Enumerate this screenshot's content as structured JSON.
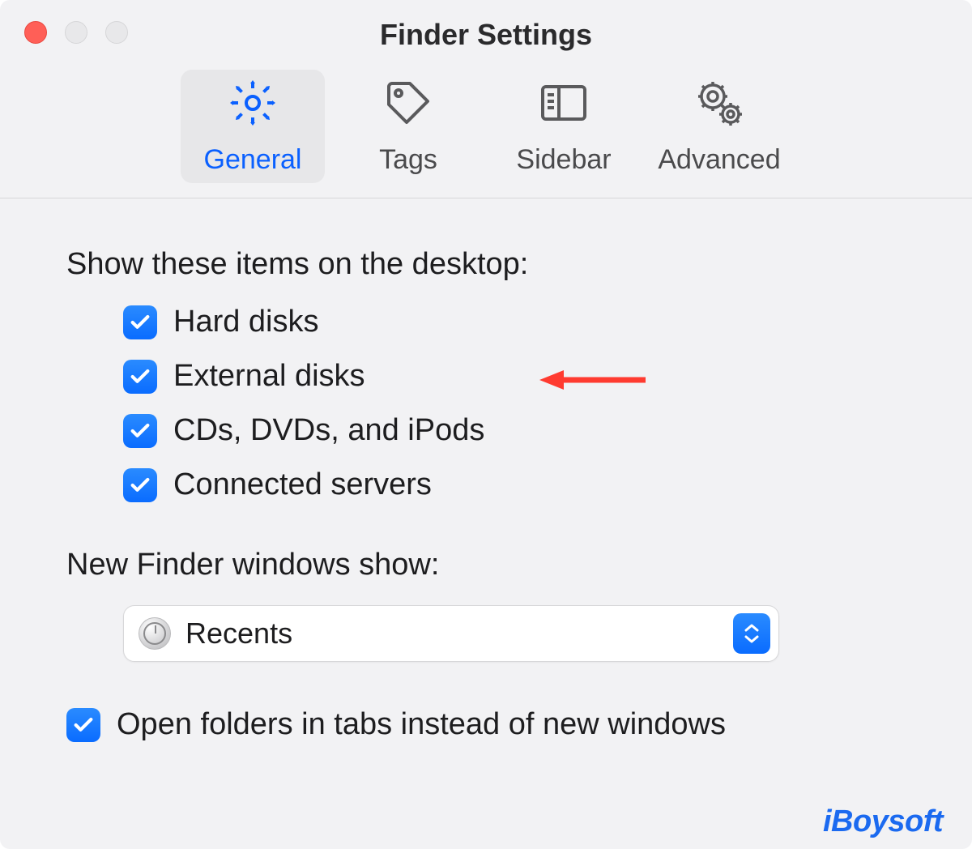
{
  "window": {
    "title": "Finder Settings"
  },
  "tabs": {
    "general": "General",
    "tags": "Tags",
    "sidebar": "Sidebar",
    "advanced": "Advanced",
    "active": "general"
  },
  "sections": {
    "show_on_desktop_heading": "Show these items on the desktop:",
    "items": {
      "hard_disks": "Hard disks",
      "external_disks": "External disks",
      "cds_dvds_ipods": "CDs, DVDs, and iPods",
      "connected_servers": "Connected servers"
    },
    "new_finder_heading": "New Finder windows show:",
    "new_finder_selected": "Recents",
    "open_in_tabs_label": "Open folders in tabs instead of new windows"
  },
  "checkbox_states": {
    "hard_disks": true,
    "external_disks": true,
    "cds_dvds_ipods": true,
    "connected_servers": true,
    "open_in_tabs": true
  },
  "watermark": "iBoysoft"
}
